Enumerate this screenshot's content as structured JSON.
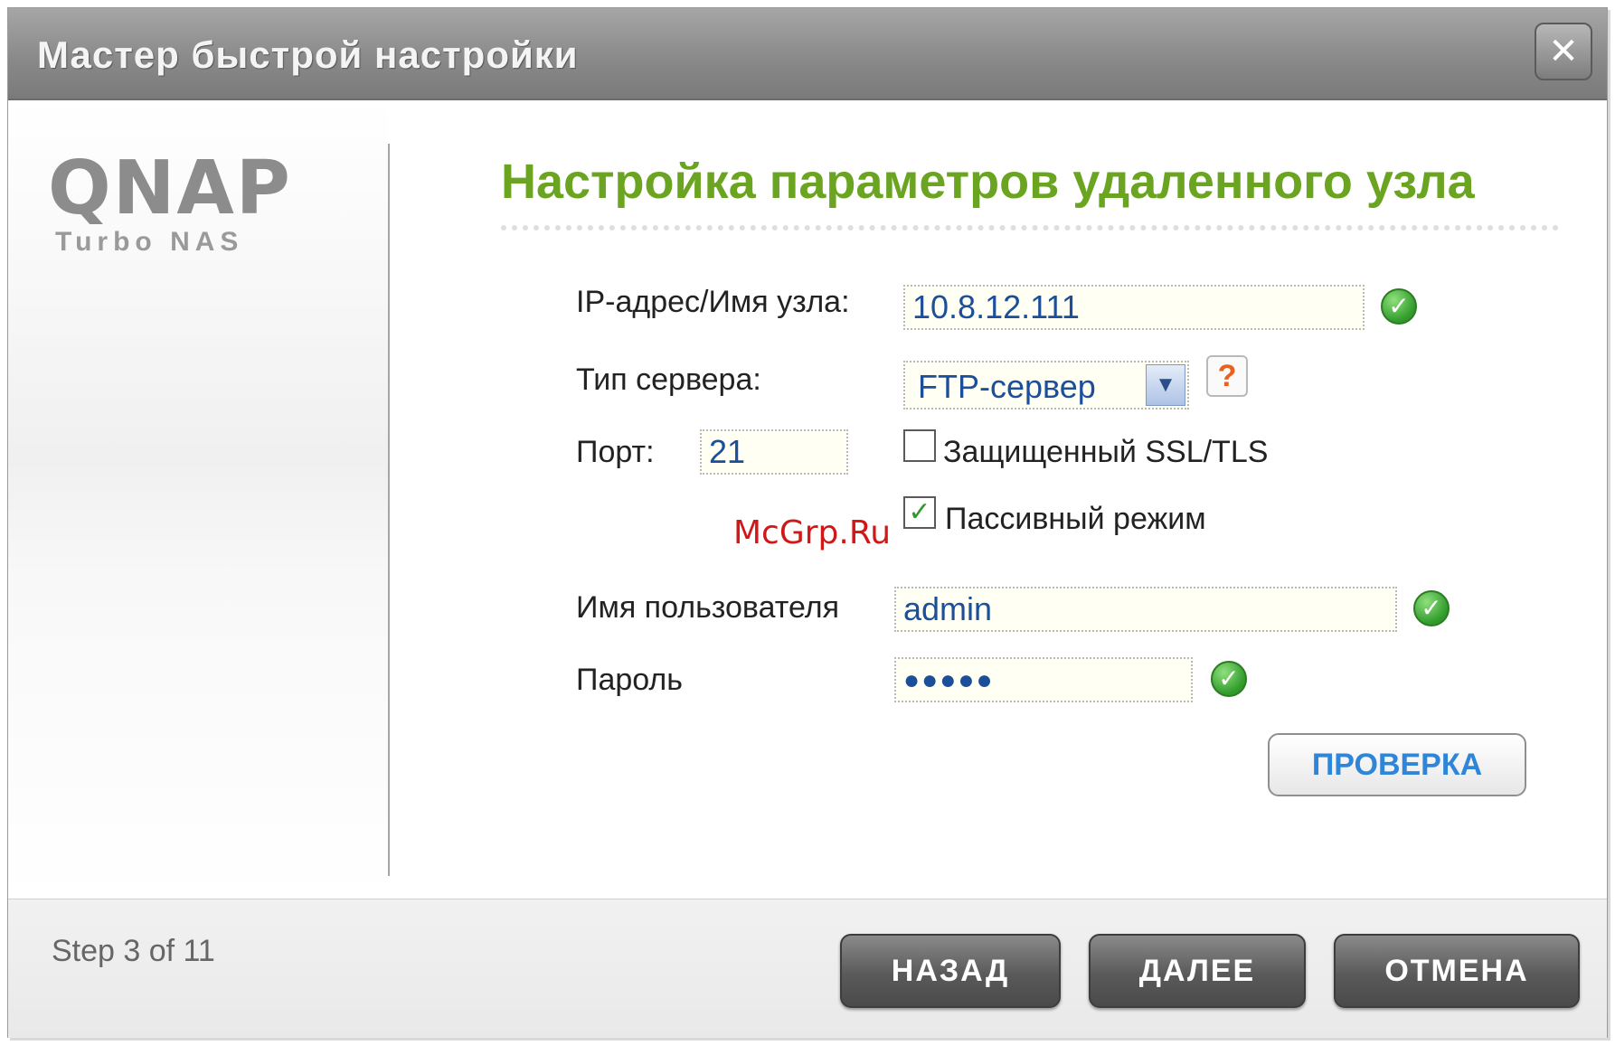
{
  "window": {
    "title": "Мастер быстрой настройки",
    "close_glyph": "✕"
  },
  "logo": {
    "brand": "QNAP",
    "product": "Turbo NAS"
  },
  "form": {
    "heading": "Настройка параметров удаленного узла",
    "host": {
      "label": "IP-адрес/Имя узла:",
      "value": "10.8.12.111"
    },
    "server_type": {
      "label": "Тип сервера:",
      "value": "FTP-сервер",
      "help_glyph": "?"
    },
    "port": {
      "label": "Порт:",
      "value": "21"
    },
    "ssl": {
      "label": "Защищенный SSL/TLS",
      "checked": false
    },
    "passive": {
      "label": "Пассивный режим",
      "checked": true
    },
    "username": {
      "label": "Имя пользователя",
      "value": "admin"
    },
    "password": {
      "label": "Пароль",
      "value": "●●●●●"
    },
    "verify_button": "ПРОВЕРКА"
  },
  "watermark": "McGrp.Ru",
  "footer": {
    "step": "Step 3 of 11",
    "back_button": "НАЗАД",
    "next_button": "ДАЛЕЕ",
    "cancel_button": "ОТМЕНА"
  },
  "icons": {
    "valid": "check-circle-icon",
    "help": "question-icon",
    "dropdown": "chevron-down-icon"
  },
  "colors": {
    "heading": "#6aa421",
    "input_text": "#1b4f9a",
    "valid": "#2f9a2a",
    "help": "#e8611e",
    "verify_text": "#2f86d8"
  }
}
